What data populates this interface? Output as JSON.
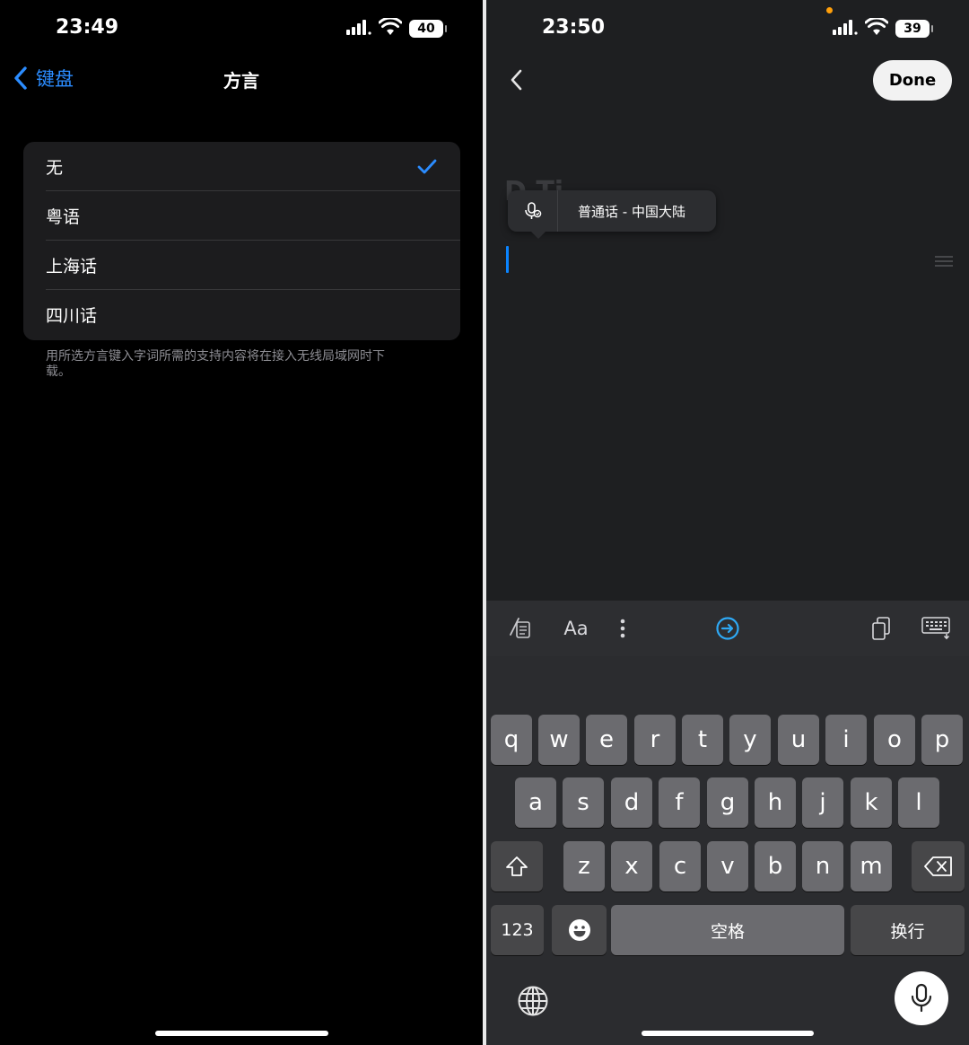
{
  "left": {
    "status": {
      "time": "23:49",
      "battery": "40"
    },
    "nav": {
      "back_label": "键盘",
      "title": "方言"
    },
    "options": [
      "无",
      "粤语",
      "上海话",
      "四川话"
    ],
    "selected_index": 0,
    "footnote": "用所选方言键入字词所需的支持内容将在接入无线局域网时下载。"
  },
  "right": {
    "status": {
      "time": "23:50",
      "battery": "39"
    },
    "done_label": "Done",
    "ghost_title": "D  Ti",
    "language_popup": "普通话 - 中国大陆",
    "toolbar": {
      "font_label": "Aa"
    },
    "keyboard": {
      "row1": [
        "q",
        "w",
        "e",
        "r",
        "t",
        "y",
        "u",
        "i",
        "o",
        "p"
      ],
      "row2": [
        "a",
        "s",
        "d",
        "f",
        "g",
        "h",
        "j",
        "k",
        "l"
      ],
      "row3": [
        "z",
        "x",
        "c",
        "v",
        "b",
        "n",
        "m"
      ],
      "numbers_label": "123",
      "space_label": "空格",
      "return_label": "换行"
    }
  },
  "colors": {
    "accent_blue": "#2b8cff",
    "orange_dot": "#ff9f0a",
    "cursor": "#0a84ff"
  }
}
